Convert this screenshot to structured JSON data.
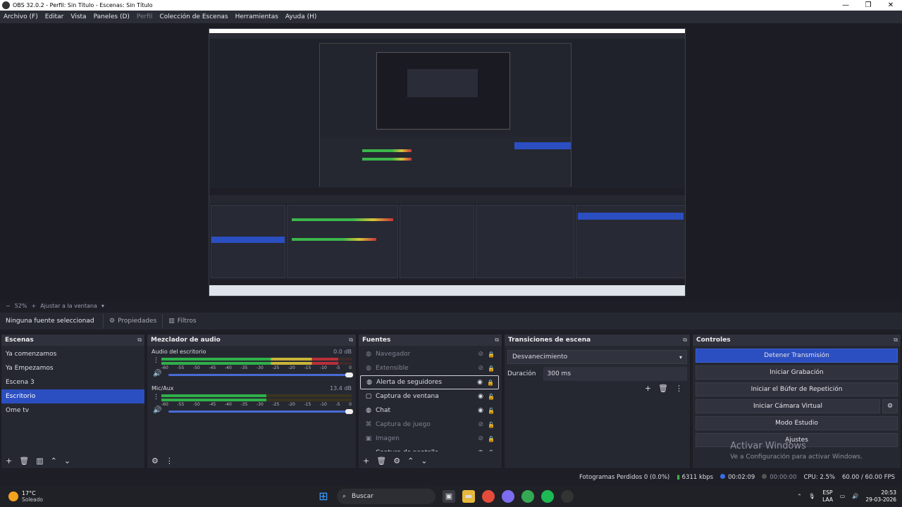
{
  "titlebar": {
    "title": "OBS 32.0.2 - Perfil: Sin Título - Escenas: Sin Título",
    "minimize": "—",
    "maximize": "❐",
    "close": "✕"
  },
  "menu": [
    "Archivo (F)",
    "Editar",
    "Vista",
    "Paneles (D)",
    "Perfil",
    "Colección de Escenas",
    "Herramientas",
    "Ayuda (H)"
  ],
  "zoombar": {
    "minus": "−",
    "zoom": "52%",
    "plus": "+",
    "fit": "Ajustar a la ventana"
  },
  "propsbar": {
    "no_source": "Ninguna fuente seleccionad",
    "properties": "Propiedades",
    "filters": "Filtros"
  },
  "scenes": {
    "title": "Escenas",
    "items": [
      "Ya comenzamos",
      "Ya Empezamos",
      "Escena 3",
      "Escritorio",
      "Ome tv"
    ],
    "active_index": 3
  },
  "mixer": {
    "title": "Mezclador de audio",
    "channels": [
      {
        "name": "Audio del escritorio",
        "db": "0.0 dB",
        "level": 0.93
      },
      {
        "name": "Mic/Aux",
        "db": "13.4 dB",
        "level": 0.55
      }
    ],
    "scale": [
      "-60",
      "-55",
      "-50",
      "-45",
      "-40",
      "-35",
      "-30",
      "-25",
      "-20",
      "-15",
      "-10",
      "-5",
      "0"
    ]
  },
  "sources": {
    "title": "Fuentes",
    "items": [
      {
        "name": "Navegador",
        "icon": "globe-icon",
        "glyph": "◍",
        "visible": false,
        "locked": true
      },
      {
        "name": "Extensible",
        "icon": "globe-icon",
        "glyph": "◍",
        "visible": false,
        "locked": true
      },
      {
        "name": "Alerta de seguidores",
        "icon": "globe-icon",
        "glyph": "◍",
        "visible": true,
        "locked": true,
        "selected": true
      },
      {
        "name": "Captura de ventana",
        "icon": "window-icon",
        "glyph": "▢",
        "visible": true,
        "locked": false
      },
      {
        "name": "Chat",
        "icon": "globe-icon",
        "glyph": "◍",
        "visible": true,
        "locked": false
      },
      {
        "name": "Captura de juego",
        "icon": "gamepad-icon",
        "glyph": "⌘",
        "visible": false,
        "locked": false
      },
      {
        "name": "Imagen",
        "icon": "image-icon",
        "glyph": "▣",
        "visible": false,
        "locked": true
      },
      {
        "name": "Captura de pantalla",
        "icon": "monitor-icon",
        "glyph": "▭",
        "visible": true,
        "locked": false
      }
    ]
  },
  "transitions": {
    "title": "Transiciones de escena",
    "selected": "Desvanecimiento",
    "duration_label": "Duración",
    "duration_value": "300 ms"
  },
  "controls": {
    "title": "Controles",
    "buttons": [
      "Detener Transmisión",
      "Iniciar Grabación",
      "Iniciar el Búfer de Repetición",
      "Iniciar Cámara Virtual",
      "Modo Estudio",
      "Ajustes"
    ]
  },
  "watermark": {
    "line1": "Activar Windows",
    "line2": "Ve a Configuración para activar Windows."
  },
  "status": {
    "dropped": "Fotogramas Perdidos 0 (0.0%)",
    "bitrate": "6311 kbps",
    "stream_time": "00:02:09",
    "rec_time": "00:00:00",
    "cpu": "CPU: 2.5%",
    "fps": "60.00 / 60.00 FPS"
  },
  "taskbar": {
    "temp": "17°C",
    "condition": "Soleado",
    "search": "Buscar",
    "lang1": "ESP",
    "lang2": "LAA",
    "time": "20:53",
    "date": "29-03-2026"
  },
  "colors": {
    "accent": "#2b4ec1",
    "bg": "#1e1f26",
    "dock": "#262831"
  }
}
